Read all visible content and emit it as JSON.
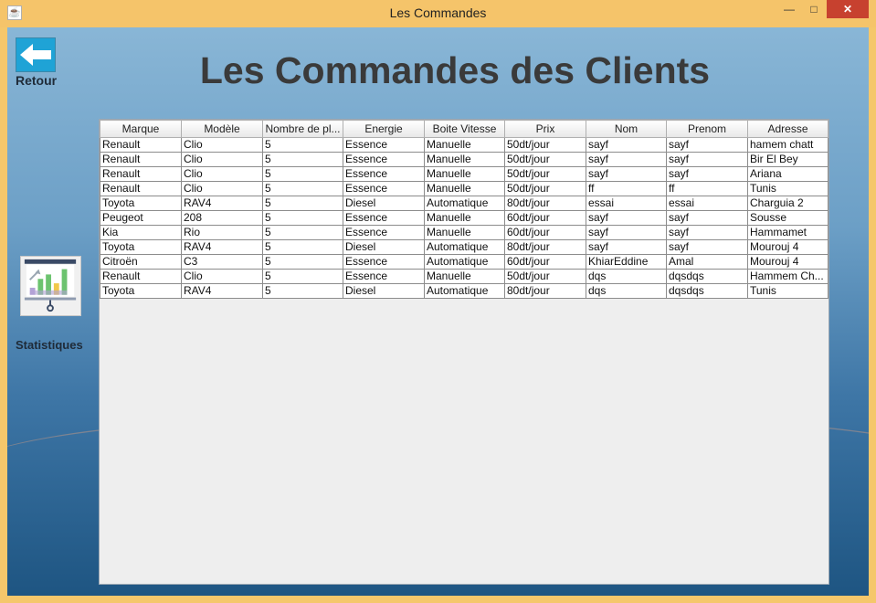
{
  "window": {
    "title": "Les Commandes",
    "min_label": "—",
    "max_label": "□",
    "close_label": "✕"
  },
  "back": {
    "label": "Retour"
  },
  "page_title": "Les Commandes des Clients",
  "stats": {
    "label": "Statistiques"
  },
  "table": {
    "columns": [
      "Marque",
      "Modèle",
      "Nombre de pl...",
      "Energie",
      "Boite Vitesse",
      "Prix",
      "Nom",
      "Prenom",
      "Adresse"
    ],
    "rows": [
      [
        "Renault",
        "Clio",
        "5",
        "Essence",
        "Manuelle",
        "50dt/jour",
        "sayf",
        "sayf",
        "hamem chatt"
      ],
      [
        "Renault",
        "Clio",
        "5",
        "Essence",
        "Manuelle",
        "50dt/jour",
        "sayf",
        "sayf",
        "Bir El Bey"
      ],
      [
        "Renault",
        "Clio",
        "5",
        "Essence",
        "Manuelle",
        "50dt/jour",
        "sayf",
        "sayf",
        "Ariana"
      ],
      [
        "Renault",
        "Clio",
        "5",
        "Essence",
        "Manuelle",
        "50dt/jour",
        "ff",
        "ff",
        "Tunis"
      ],
      [
        "Toyota",
        "RAV4",
        "5",
        "Diesel",
        "Automatique",
        "80dt/jour",
        "essai",
        "essai",
        "Charguia 2"
      ],
      [
        "Peugeot",
        "208",
        "5",
        "Essence",
        "Manuelle",
        "60dt/jour",
        "sayf",
        "sayf",
        "Sousse"
      ],
      [
        "Kia",
        "Rio",
        "5",
        "Essence",
        "Manuelle",
        "60dt/jour",
        "sayf",
        "sayf",
        "Hammamet"
      ],
      [
        "Toyota",
        "RAV4",
        "5",
        "Diesel",
        "Automatique",
        "80dt/jour",
        "sayf",
        "sayf",
        "Mourouj 4"
      ],
      [
        "Citroën",
        "C3",
        "5",
        "Essence",
        "Automatique",
        "60dt/jour",
        "KhiarEddine",
        "Amal",
        "Mourouj 4"
      ],
      [
        "Renault",
        "Clio",
        "5",
        "Essence",
        "Manuelle",
        "50dt/jour",
        "dqs",
        "dqsdqs",
        "Hammem Ch..."
      ],
      [
        "Toyota",
        "RAV4",
        "5",
        "Diesel",
        "Automatique",
        "80dt/jour",
        "dqs",
        "dqsdqs",
        "Tunis"
      ]
    ]
  },
  "colors": {
    "accent": "#1fa3d6",
    "title_bar": "#f5c46a",
    "close": "#c7412f"
  }
}
